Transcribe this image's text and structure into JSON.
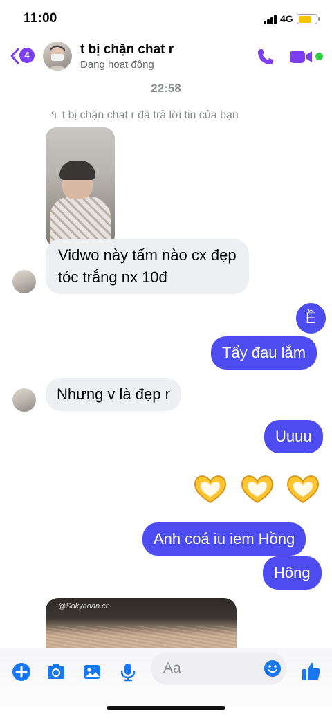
{
  "status_bar": {
    "time": "11:00",
    "network": "4G",
    "battery_level": 0.7,
    "battery_color": "#f5c400"
  },
  "header": {
    "back_badge": "4",
    "contact_name": "t bị chặn chat r",
    "contact_status": "Đang hoạt động",
    "accent_color": "#7b3ef0",
    "online_color": "#31cc46",
    "icons": [
      "back-arrow-icon",
      "phone-icon",
      "video-camera-icon"
    ]
  },
  "chat": {
    "timestamp": "22:58",
    "reply_note": "t bị chặn chat r đã trả lời tin của bạn",
    "messages": [
      {
        "side": "in",
        "text_line1": "Vidwo này tấm nào cx đẹp",
        "text_line2": "tóc trắng nx 10đ"
      },
      {
        "side": "out",
        "text": "Ề"
      },
      {
        "side": "out",
        "text": "Tẩy đau lắm"
      },
      {
        "side": "in",
        "text": "Nhưng v là đẹp r"
      },
      {
        "side": "out",
        "text": "Uuuu"
      },
      {
        "side": "out",
        "text": "Anh coá iu iem Hồng"
      },
      {
        "side": "out",
        "text": "Hông"
      }
    ],
    "emoji_message": "🫶🫶🫶",
    "media_watermark": "@Sokyaoan.cn",
    "outgoing_color": "#4c4cf0",
    "incoming_color": "#eeeff2"
  },
  "composer": {
    "placeholder": "Aa",
    "icons": [
      "plus-icon",
      "camera-icon",
      "gallery-icon",
      "microphone-icon",
      "emoji-icon",
      "like-icon"
    ],
    "accent_color": "#1877f2"
  }
}
